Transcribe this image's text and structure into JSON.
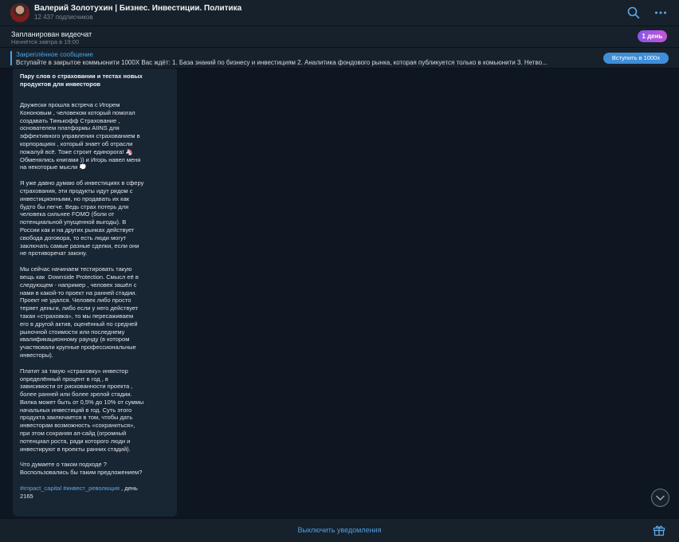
{
  "header": {
    "title": "Валерий Золотухин | Бизнес. Инвестиции. Политика",
    "subscribers": "12 437 подписчиков",
    "icons": [
      "search-icon",
      "more-icon"
    ]
  },
  "video_chat": {
    "title": "Запланирован видеочат",
    "subtitle": "Начнётся завтра в 19:00",
    "badge": "1 день"
  },
  "pinned": {
    "title": "Закреплённое сообщение",
    "text": "Вступайте в закрытое коммьюнити 1000Х   Вас ждёт:  1. База знаний по бизнесу и инвестициям  2. Аналитика фондового рынка, которая публикуется только в комьюнити 3. Нетво...",
    "button": "Вступить в 1000х"
  },
  "message": {
    "title": "Пару слов о страховании и тестах новых продуктов для инвесторов",
    "paragraphs": [
      "Дружески прошла встреча с Игорем\nКононовым , человеком который помогал\nсоздавать Тинькофф Страхование ,\nоснователем платформы AIINS для\nэффективного управления страхованием в\nкорпорациях , который знает об отрасли\nпожалуй всё. Тоже строит единорога! 🦄\nОбменялись книгами )) и Игорь навел меня\nна некоторые мысли 💭",
      "Я уже давно думаю об инвестициях в сферу\nстрахования, эти продукты идут рядом с\nинвестиционными, но продавать их как\nбудто бы легче. Ведь страх потерь для\nчеловека сильнее FOMO (боли от\nпотенциальной упущенной выгоды). В\nРоссии как и на других рынках действует\nсвобода договора, то есть люди могут\nзаключать самые разные сделки, если они\nне противоречат закону.",
      "Мы сейчас начинаем тестировать такую\nвещь как  Downside Protection. Смысл её в\nследующем - например , человек зашёл с\nнами в какой-то проект на ранней стадии.\nПроект не удался. Человек либо просто\nтеряет деньги, либо если у него действует\nтакая «страховка», то мы пересаживаем\nего в другой актив, оценённый по средней\nрыночной стоимости или последнему\nквалификационному раунду (в котором\nучаствовали крупные профессиональные\nинвесторы).",
      "Платит за такую «страховку» инвестор\nопределённый процент в год , в\nзависимости от рискованности проекта ,\nболее ранней или более зрелой стадии.\nВилка может быть от 0,5% до 10% от суммы\nначальных инвестиций в год. Суть этого\nпродукта заключается в том, чтобы дать\nинвесторам возможность «сохраниться»,\nпри этом сохраняя ап-сайд (огромный\nпотенциал роста, ради которого люди и\nинвестируют в проекты ранних стадий).",
      "Что думаете о таком подходе ?\nВоспользовались бы таким предложением?"
    ],
    "tag1": "#impact_capital",
    "tag2": "#инвест_революция",
    "tail": " , день\n2165"
  },
  "bottom": {
    "mute_label": "Выключить уведомления",
    "icons": [
      "gift-icon",
      "chevron-down-icon"
    ]
  },
  "colors": {
    "background": "#0e1621",
    "panel": "#17212b",
    "bubble": "#182533",
    "accent": "#4aa3e8"
  }
}
